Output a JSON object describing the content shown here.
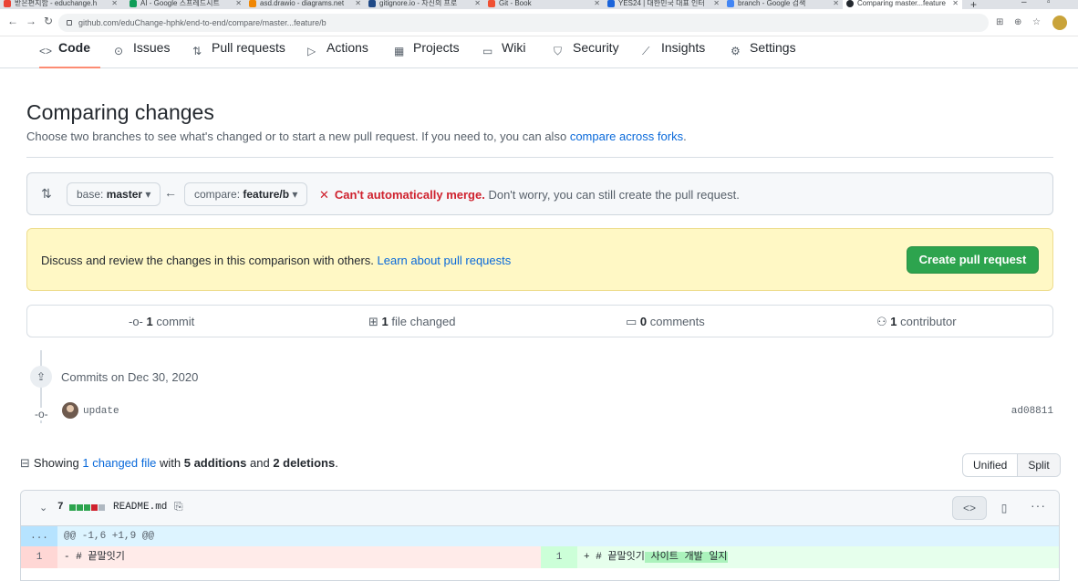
{
  "browser": {
    "tabs": [
      {
        "title": "받은편지함 - educhange.h"
      },
      {
        "title": "AI - Google 스프레드시트"
      },
      {
        "title": "asd.drawio - diagrams.net"
      },
      {
        "title": "gitignore.io - 자신의 프로"
      },
      {
        "title": "Git - Book"
      },
      {
        "title": "YES24 | 대한민국 대표 인터"
      },
      {
        "title": "branch - Google 검색"
      },
      {
        "title": "Comparing master...feature"
      }
    ],
    "url": "github.com/eduChange-hphk/end-to-end/compare/master...feature/b"
  },
  "repo_nav": {
    "tabs": [
      {
        "label": "Code",
        "icon": "code-icon"
      },
      {
        "label": "Issues",
        "icon": "issue-icon"
      },
      {
        "label": "Pull requests",
        "icon": "pull-request-icon"
      },
      {
        "label": "Actions",
        "icon": "play-icon"
      },
      {
        "label": "Projects",
        "icon": "project-icon"
      },
      {
        "label": "Wiki",
        "icon": "book-icon"
      },
      {
        "label": "Security",
        "icon": "shield-icon"
      },
      {
        "label": "Insights",
        "icon": "graph-icon"
      },
      {
        "label": "Settings",
        "icon": "gear-icon"
      }
    ]
  },
  "page": {
    "title": "Comparing changes",
    "subtitle": "Choose two branches to see what's changed or to start a new pull request. If you need to, you can also",
    "subtitle_link": "compare across forks",
    "subtitle_end": "."
  },
  "range": {
    "base_label": "base:",
    "base_branch": "master",
    "compare_label": "compare:",
    "compare_branch": "feature/b",
    "merge_status": "Can't automatically merge.",
    "merge_note": "Don't worry, you can still create the pull request."
  },
  "flash": {
    "text": "Discuss and review the changes in this comparison with others.",
    "link": "Learn about pull requests",
    "button": "Create pull request"
  },
  "stats": {
    "commits_count": "1",
    "commits_label": "commit",
    "files_count": "1",
    "files_label": "file changed",
    "comments_count": "0",
    "comments_label": "comments",
    "contributors_count": "1",
    "contributors_label": "contributor"
  },
  "commits": {
    "date_heading": "Commits on Dec 30, 2020",
    "items": [
      {
        "message": "update",
        "sha": "ad08811"
      }
    ]
  },
  "diff_summary": {
    "prefix": "Showing",
    "files_link": "1 changed file",
    "with": "with",
    "additions": "5 additions",
    "and": "and",
    "deletions": "2 deletions",
    "end": ".",
    "view_unified": "Unified",
    "view_split": "Split"
  },
  "file": {
    "change_count": "7",
    "name": "README.md",
    "hunk_dots": "...",
    "hunk_header": "@@ -1,6 +1,9 @@",
    "left_line_no": "1",
    "left_line": "- # 끝말잇기",
    "right_line_no": "1",
    "right_line_plain": "+ # 끝말잇기",
    "right_line_added": " 사이트 개발 일지"
  },
  "colors": {
    "accent": "#fd8c73",
    "green": "#2da44e",
    "red": "#cf222e",
    "link": "#0969da"
  }
}
